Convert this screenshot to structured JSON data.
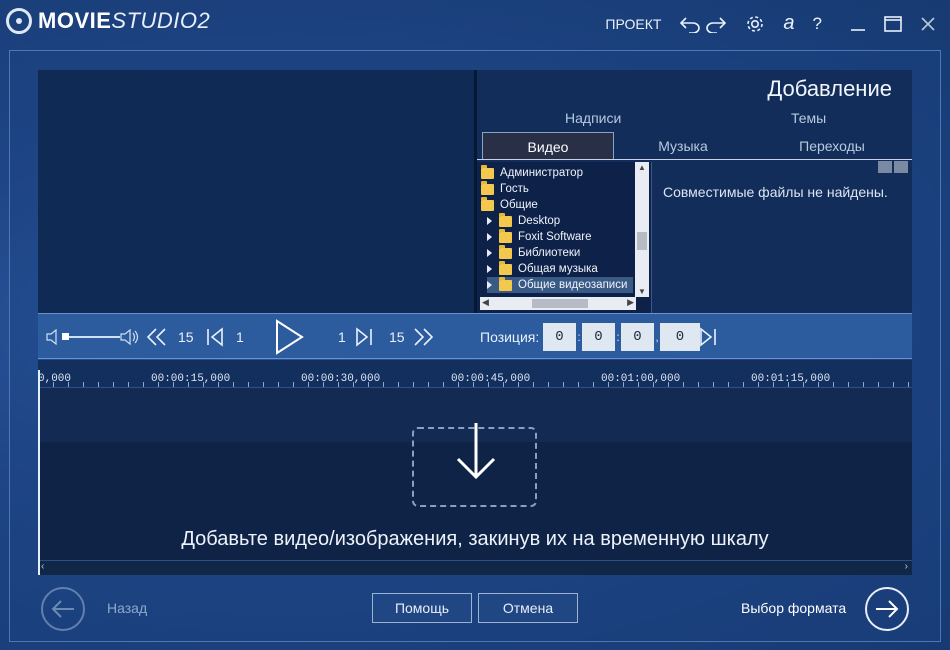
{
  "app": {
    "logo_bold": "MOVIE",
    "logo_italic": "STUDIO2",
    "project_label": "ПРОЕКТ",
    "letter_a": "a",
    "help_label": "?"
  },
  "add_panel": {
    "title": "Добавление",
    "subtabs": [
      "Надписи",
      "Темы"
    ],
    "tabs": [
      {
        "label": "Видео",
        "active": true
      },
      {
        "label": "Музыка",
        "active": false
      },
      {
        "label": "Переходы",
        "active": false
      }
    ],
    "tree": [
      {
        "label": "Администратор",
        "level": 0
      },
      {
        "label": "Гость",
        "level": 0
      },
      {
        "label": "Общие",
        "level": 0
      },
      {
        "label": "Desktop",
        "level": 1
      },
      {
        "label": "Foxit Software",
        "level": 1
      },
      {
        "label": "Библиотеки",
        "level": 1
      },
      {
        "label": "Общая музыка",
        "level": 1
      },
      {
        "label": "Общие видеозаписи",
        "level": 1,
        "selected": true
      }
    ],
    "empty_message": "Совместимые файлы не найдены."
  },
  "transport": {
    "skip_back_big": "15",
    "skip_back_small": "1",
    "skip_fwd_small": "1",
    "skip_fwd_big": "15",
    "position_label": "Позиция:",
    "position": [
      "0",
      "0",
      "0",
      "0"
    ],
    "volume_level": 0.0
  },
  "timeline": {
    "ruler_labels": [
      "0,000",
      "00:00:15,000",
      "00:00:30,000",
      "00:00:45,000",
      "00:01:00,000",
      "00:01:15,000"
    ],
    "drop_hint": "Добавьте видео/изображения, закинув их на временную шкалу"
  },
  "footer": {
    "back_label": "Назад",
    "help_label": "Помощь",
    "cancel_label": "Отмена",
    "next_label": "Выбор формата"
  }
}
